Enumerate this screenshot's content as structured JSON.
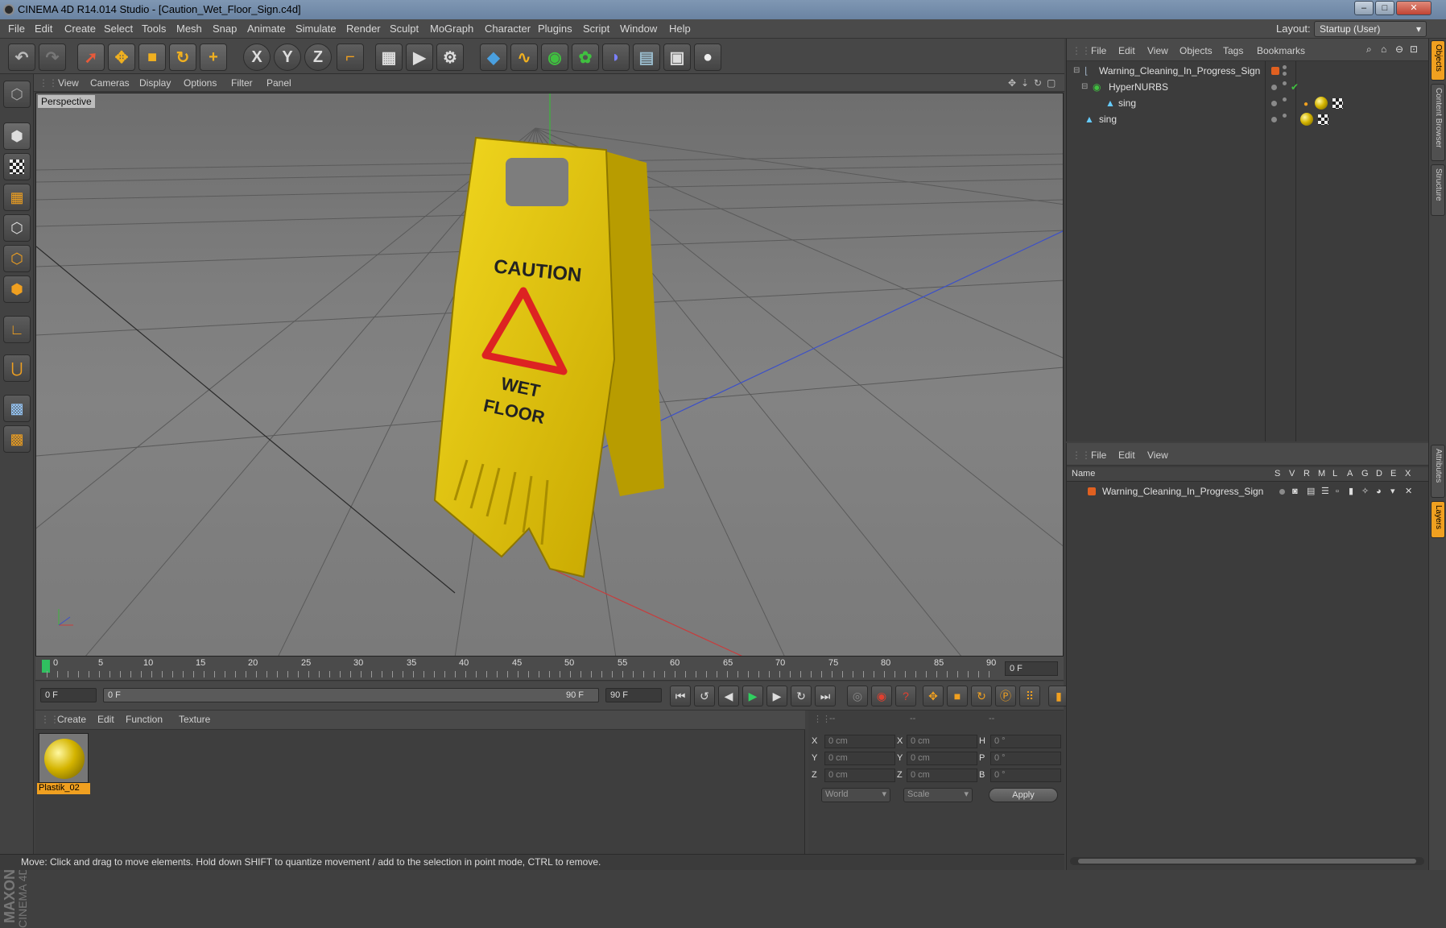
{
  "window": {
    "title": "CINEMA 4D R14.014 Studio - [Caution_Wet_Floor_Sign.c4d]",
    "minimize": "–",
    "maximize": "□",
    "close": "✕"
  },
  "menubar": {
    "items": [
      "File",
      "Edit",
      "Create",
      "Select",
      "Tools",
      "Mesh",
      "Snap",
      "Animate",
      "Simulate",
      "Render",
      "Sculpt",
      "MoGraph",
      "Character",
      "Plugins",
      "Script",
      "Window",
      "Help"
    ],
    "layout_label": "Layout:",
    "layout_value": "Startup (User)"
  },
  "toolbar": {
    "axis_x": "X",
    "axis_y": "Y",
    "axis_z": "Z"
  },
  "viewport": {
    "menu": [
      "View",
      "Cameras",
      "Display",
      "Options",
      "Filter",
      "Panel"
    ],
    "label": "Perspective",
    "sign_text_top": "CAUTION",
    "sign_text_mid": "WET",
    "sign_text_bottom": "FLOOR"
  },
  "timeline": {
    "ticks": [
      "0",
      "5",
      "10",
      "15",
      "20",
      "25",
      "30",
      "35",
      "40",
      "45",
      "50",
      "55",
      "60",
      "65",
      "70",
      "75",
      "80",
      "85",
      "90"
    ],
    "current_frame": "0 F"
  },
  "playbar": {
    "start_field": "0 F",
    "range_start": "0 F",
    "range_end": "90 F",
    "end_field": "90 F"
  },
  "materials": {
    "menu": [
      "Create",
      "Edit",
      "Function",
      "Texture"
    ],
    "items": [
      {
        "name": "Plastik_02"
      }
    ]
  },
  "coordinates": {
    "header": [
      "--",
      "--",
      "--"
    ],
    "rows": [
      {
        "a": "X",
        "av": "0 cm",
        "b": "X",
        "bv": "0 cm",
        "c": "H",
        "cv": "0 °"
      },
      {
        "a": "Y",
        "av": "0 cm",
        "b": "Y",
        "bv": "0 cm",
        "c": "P",
        "cv": "0 °"
      },
      {
        "a": "Z",
        "av": "0 cm",
        "b": "Z",
        "bv": "0 cm",
        "c": "B",
        "cv": "0 °"
      }
    ],
    "space": "World",
    "mode": "Scale",
    "apply": "Apply"
  },
  "status": "Move: Click and drag to move elements. Hold down SHIFT to quantize movement / add to the selection in point mode, CTRL to remove.",
  "objects": {
    "menu": [
      "File",
      "Edit",
      "View",
      "Objects",
      "Tags",
      "Bookmarks"
    ],
    "tree": [
      {
        "name": "Warning_Cleaning_In_Progress_Sign",
        "depth": 0
      },
      {
        "name": "HyperNURBS",
        "depth": 1
      },
      {
        "name": "sing",
        "depth": 2
      },
      {
        "name": "sing",
        "depth": 0
      }
    ]
  },
  "layers": {
    "menu": [
      "File",
      "Edit",
      "View"
    ],
    "columns": [
      "Name",
      "S",
      "V",
      "R",
      "M",
      "L",
      "A",
      "G",
      "D",
      "E",
      "X"
    ],
    "rows": [
      {
        "name": "Warning_Cleaning_In_Progress_Sign"
      }
    ]
  },
  "right_tabs": [
    "Objects",
    "Content Browser",
    "Structure",
    "Attributes",
    "Layers"
  ],
  "brand": {
    "maxon": "MAXON",
    "cinema": "CINEMA 4D"
  },
  "colors": {
    "accent": "#f0a020",
    "axis_x": "#c83c3c",
    "axis_y": "#3cb43c",
    "axis_z": "#3c50c8",
    "sign": "#e6c814"
  }
}
